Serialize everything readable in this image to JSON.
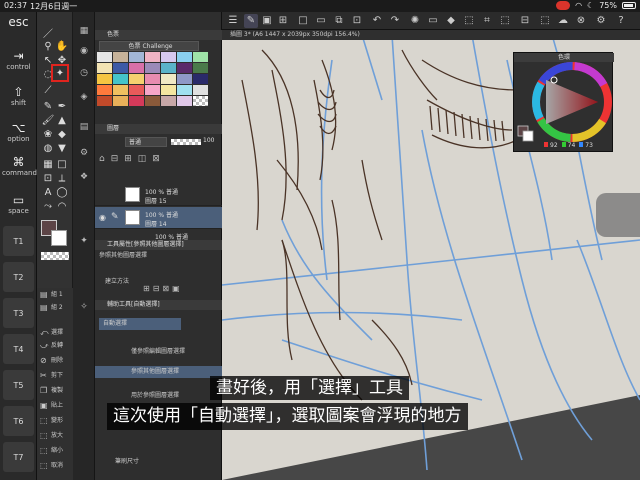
{
  "status": {
    "time": "02:37",
    "date": "12月6日週一",
    "battery": "75%"
  },
  "keypad": {
    "keys": [
      {
        "sym": "esc",
        "label": ""
      },
      {
        "sym": "⇥",
        "label": "control"
      },
      {
        "sym": "⇧",
        "label": "shift"
      },
      {
        "sym": "⌥",
        "label": "option"
      },
      {
        "sym": "⌘",
        "label": "command"
      },
      {
        "sym": "▭",
        "label": "space"
      }
    ],
    "buttons": [
      "T1",
      "T2",
      "T3",
      "T4",
      "T5",
      "T6",
      "T7"
    ]
  },
  "palette_panel": {
    "title": "色票",
    "set_name": "色票 Challenge"
  },
  "layer_panel": {
    "title": "圖層",
    "blend_mode": "普通",
    "opacity": "100",
    "layers": [
      {
        "line1": "100 % 普通",
        "line2": "圖層 15"
      },
      {
        "line1": "100 % 普通",
        "line2": "圖層 14"
      },
      {
        "line1": "100 % 普通",
        "line2": ""
      }
    ]
  },
  "tool_property": {
    "title": "工具屬性[參照其他圖層選擇]",
    "item": "參照其他圖層選擇",
    "create_method": "建立方法"
  },
  "sub_tool_panel": {
    "title": "輔助工具[自動選擇]",
    "group": "自動選擇",
    "items": [
      "僅參照編輯圖層選擇",
      "參照其他圖層選擇",
      "用於參照圖層選擇"
    ],
    "brush_size": "筆刷尺寸"
  },
  "left_sub_items": [
    "組 1",
    "組 2"
  ],
  "left_menu": [
    "選擇",
    "反轉",
    "刪除",
    "剪下",
    "複製",
    "貼上",
    "變形",
    "放大",
    "縮小",
    "取消"
  ],
  "canvas": {
    "tab_label": "插圖 3* (A6 1447 x 2039px 350dpi 156.4%)"
  },
  "color_circle": {
    "title": "色環",
    "h": "92",
    "s": "74",
    "v": "73"
  },
  "subtitles": {
    "line1": "畫好後，用「選擇」工具",
    "line2": "這次使用「自動選擇」，選取圖案會浮現的地方"
  },
  "colors": {
    "highlight": "#e0241e",
    "selected_row": "#4b5f7a",
    "canvas_paper": "#d9d6cf",
    "sketch_blue": "#6f9fd8",
    "line_brown": "#4a3326"
  }
}
